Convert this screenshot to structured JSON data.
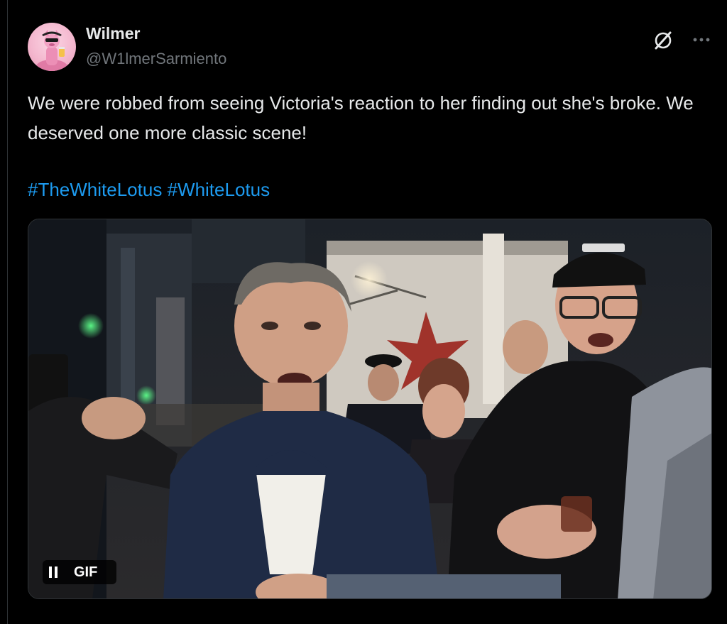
{
  "tweet": {
    "author_name": "Wilmer",
    "author_handle": "@W1lmerSarmiento",
    "text": "We were robbed from seeing Victoria's reaction to her finding out she's broke. We deserved one more classic scene!",
    "hashtags": [
      "#TheWhiteLotus",
      "#WhiteLotus"
    ]
  },
  "media": {
    "badge_label": "GIF",
    "state": "playing"
  },
  "icons": {
    "avatar": "pink-panther-avatar",
    "grok": "grok-icon",
    "more": "more-icon",
    "pause": "pause-icon"
  },
  "colors": {
    "background": "#000000",
    "text": "#e7e9ea",
    "secondary_text": "#71767b",
    "link": "#1d9bf0"
  }
}
